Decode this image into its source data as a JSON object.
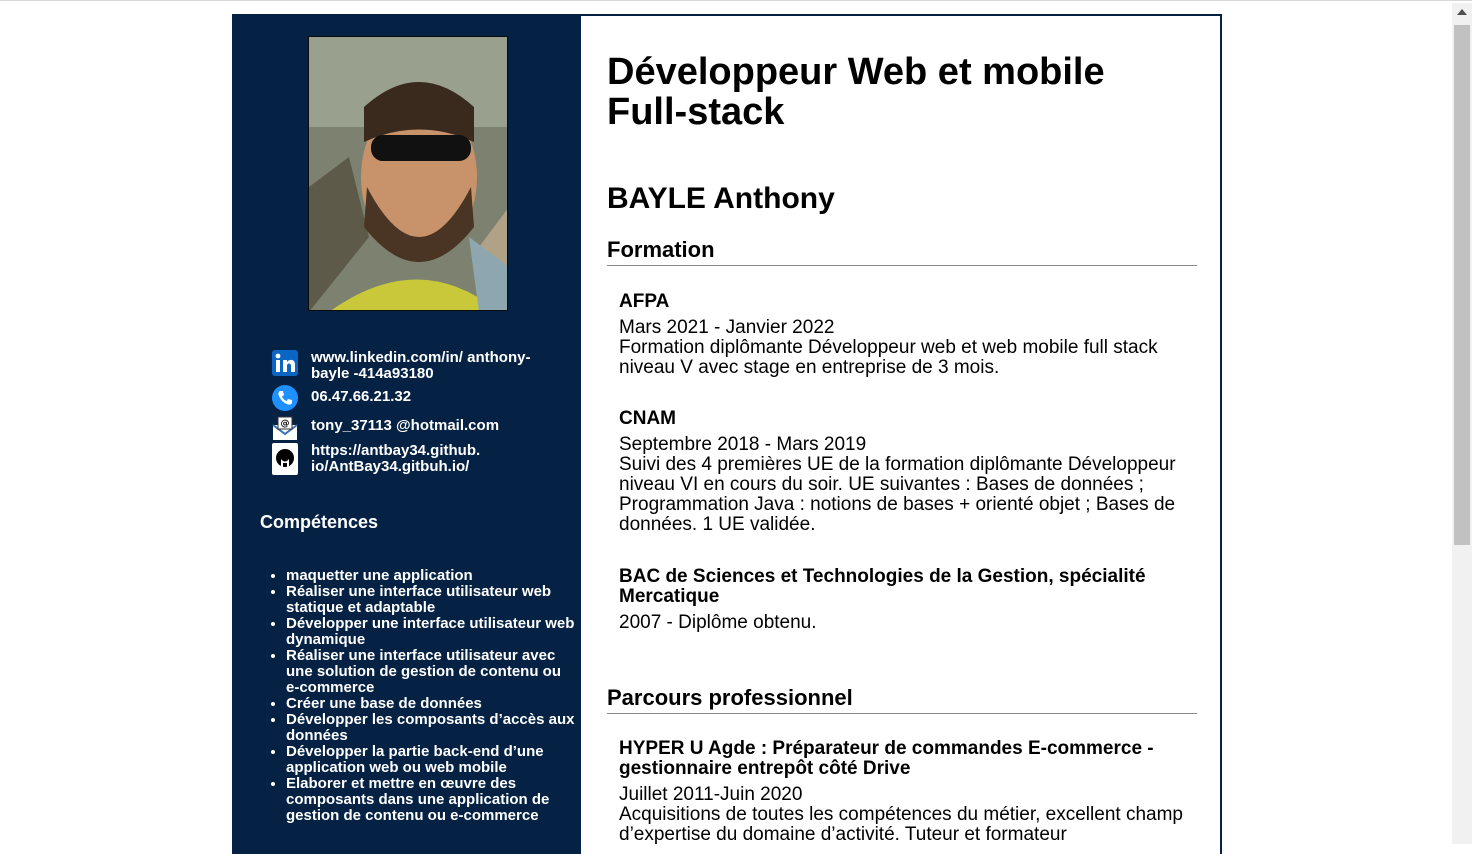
{
  "sidebar": {
    "contacts": [
      {
        "icon": "linkedin-icon",
        "text": "www.linkedin.com/in/ anthony-bayle -414a93180"
      },
      {
        "icon": "phone-icon",
        "text": "06.47.66.21.32"
      },
      {
        "icon": "email-icon",
        "text": "tony_37113 @hotmail.com"
      },
      {
        "icon": "github-icon",
        "text": "https://antbay34.github. io/AntBay34.gitbuh.io/"
      }
    ],
    "skills_title": "Compétences",
    "skills": [
      "maquetter une application",
      "Réaliser une interface utilisateur web statique et adaptable",
      "Développer une interface utilisateur web dynamique",
      "Réaliser une interface utilisateur avec une solution de gestion de contenu ou e-commerce",
      "Créer une base de données",
      "Développer les composants d’accès aux données",
      "Développer la partie back-end d’une application web ou web mobile",
      "Elaborer et mettre en œuvre des composants dans une application de gestion de contenu ou e-commerce"
    ]
  },
  "main": {
    "title": "Développeur Web et mobile Full-stack",
    "name": "BAYLE Anthony",
    "formation_title": "Formation",
    "formations": [
      {
        "title": "AFPA",
        "dates": "Mars 2021 - Janvier 2022",
        "desc": "Formation diplômante Développeur web et web mobile full stack niveau V avec stage en entreprise de 3 mois."
      },
      {
        "title": "CNAM",
        "dates": "Septembre 2018 - Mars 2019",
        "desc": "Suivi des 4 premières UE de la formation diplômante Développeur niveau VI en cours du soir. UE suivantes : Bases de données ; Programmation Java : notions de bases + orienté objet ; Bases de données. 1 UE validée."
      },
      {
        "title": "BAC de Sciences et Technologies de la Gestion, spécialité Mercatique",
        "dates": "2007 - Diplôme obtenu.",
        "desc": ""
      }
    ],
    "parcours_title": "Parcours professionnel",
    "jobs": [
      {
        "title": "HYPER U Agde : Préparateur de commandes E-commerce - gestionnaire entrepôt côté Drive",
        "dates": "Juillet 2011-Juin 2020",
        "desc": "Acquisitions de toutes les compétences du métier, excellent champ d’expertise du domaine d’activité. Tuteur et formateur"
      }
    ]
  },
  "colors": {
    "sidebar_bg": "#052244",
    "link_blue": "#0a66c2"
  }
}
